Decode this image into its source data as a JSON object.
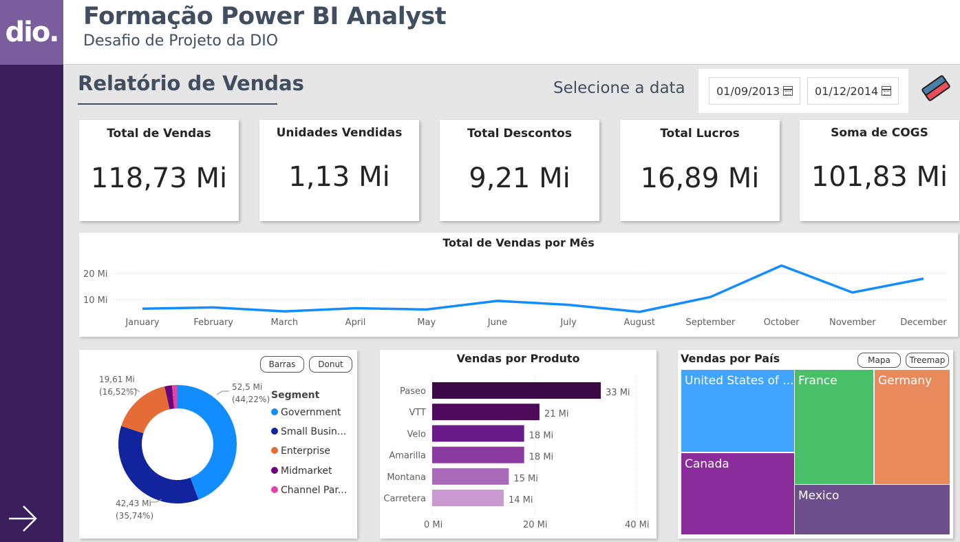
{
  "header": {
    "logo": "dio.",
    "title": "Formação Power BI Analyst",
    "subtitle": "Desafio de Projeto da DIO"
  },
  "report": {
    "title": "Relatório de Vendas",
    "date_label": "Selecione a data",
    "date_start": "01/09/2013",
    "date_end": "01/12/2014"
  },
  "kpis": [
    {
      "label": "Total de Vendas",
      "value": "118,73 Mi"
    },
    {
      "label": "Unidades Vendidas",
      "value": "1,13 Mi"
    },
    {
      "label": "Total Descontos",
      "value": "9,21 Mi"
    },
    {
      "label": "Total Lucros",
      "value": "16,89 Mi"
    },
    {
      "label": "Soma de COGS",
      "value": "101,83 Mi"
    }
  ],
  "buttons": {
    "barras": "Barras",
    "donut": "Donut",
    "mapa": "Mapa",
    "treemap": "Treemap"
  },
  "colors": {
    "line": "#118dff",
    "government": "#118dff",
    "small_business": "#12239e",
    "enterprise": "#e66c37",
    "midmarket": "#6b007b",
    "channel_partners": "#e044a7"
  },
  "chart_data": [
    {
      "type": "line",
      "title": "Total de Vendas por Mês",
      "xlabel": "",
      "ylabel": "",
      "x": [
        "January",
        "February",
        "March",
        "April",
        "May",
        "June",
        "July",
        "August",
        "September",
        "October",
        "November",
        "December"
      ],
      "series": [
        {
          "values": [
            6.5,
            7.0,
            5.5,
            6.7,
            6.2,
            9.5,
            8.0,
            5.3,
            11.0,
            23.0,
            12.7,
            18.0
          ]
        }
      ],
      "yticks": [
        "10 Mi",
        "20 Mi"
      ],
      "ylim": [
        0,
        25
      ],
      "grid": true
    },
    {
      "type": "pie",
      "subtype": "donut",
      "legend_title": "Segment",
      "labels": [
        "Government",
        "Small Busin...",
        "Enterprise",
        "Midmarket",
        "Channel Par..."
      ],
      "values": [
        52.5,
        42.43,
        19.61,
        2.4,
        1.79
      ],
      "data_labels": [
        {
          "value": "52,5 Mi",
          "percent": "(44,22%)"
        },
        {
          "value": "42,43 Mi",
          "percent": "(35,74%)"
        },
        {
          "value": "19,61 Mi",
          "percent": "(16,52%)"
        }
      ]
    },
    {
      "type": "bar",
      "orientation": "horizontal",
      "title": "Vendas por Produto",
      "categories": [
        "Paseo",
        "VTT",
        "Velo",
        "Amarilla",
        "Montana",
        "Carretera"
      ],
      "values": [
        33,
        21,
        18,
        18,
        15,
        14
      ],
      "value_labels": [
        "33 Mi",
        "21 Mi",
        "18 Mi",
        "18 Mi",
        "15 Mi",
        "14 Mi"
      ],
      "bar_colors": [
        "#3b0a45",
        "#4f0a5c",
        "#6a1b8a",
        "#8a3aa0",
        "#a96bb8",
        "#c99ad0"
      ],
      "xticks": [
        "0 Mi",
        "20 Mi",
        "40 Mi"
      ],
      "xlim": [
        0,
        40
      ]
    },
    {
      "type": "treemap",
      "title": "Vendas por País",
      "labels": [
        "United States of ...",
        "Canada",
        "France",
        "Germany",
        "Mexico"
      ],
      "colors": [
        "#41a4ff",
        "#8a2d9a",
        "#4abf69",
        "#e88a5c",
        "#6d4f8e"
      ]
    }
  ]
}
